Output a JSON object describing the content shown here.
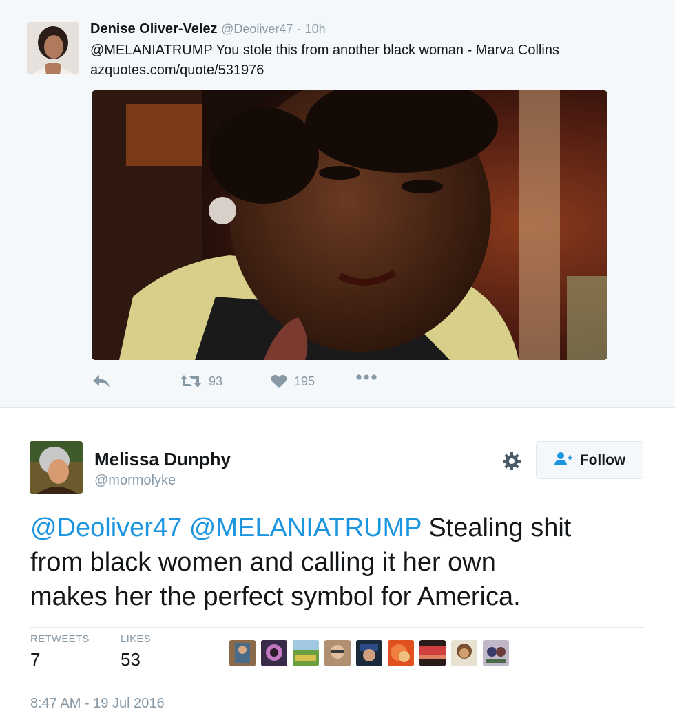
{
  "tweet1": {
    "author_name": "Denise Oliver-Velez",
    "author_handle": "@Deoliver47",
    "separator": "·",
    "time": "10h",
    "text_mention": "@MELANIATRUMP",
    "text_body": " You stole this from another black woman - Marva Collins",
    "link": "azquotes.com/quote/531976",
    "retweet_count": "93",
    "like_count": "195",
    "icons": {
      "reply": "reply-icon",
      "retweet": "retweet-icon",
      "like": "heart-icon",
      "more": "more-icon"
    }
  },
  "tweet2": {
    "author_name": "Melissa Dunphy",
    "author_handle": "@mormolyke",
    "follow_label": "Follow",
    "text_lines": [
      {
        "mention": "@Deoliver47 @MELANIATRUMP",
        "rest": " Stealing shit"
      },
      {
        "mention": "",
        "rest": "from black women and calling it her own"
      },
      {
        "mention": "",
        "rest": "makes her the perfect symbol for America."
      }
    ],
    "retweets_label": "RETWEETS",
    "retweets_value": "7",
    "likes_label": "LIKES",
    "likes_value": "53",
    "timestamp": "8:47 AM - 19 Jul 2016",
    "icons": {
      "settings": "gear-icon",
      "follow": "add-user-icon"
    }
  },
  "colors": {
    "link": "#1b95e0",
    "muted": "#8899a6",
    "text": "#14171a",
    "panel_bg": "#f5f8fa"
  }
}
